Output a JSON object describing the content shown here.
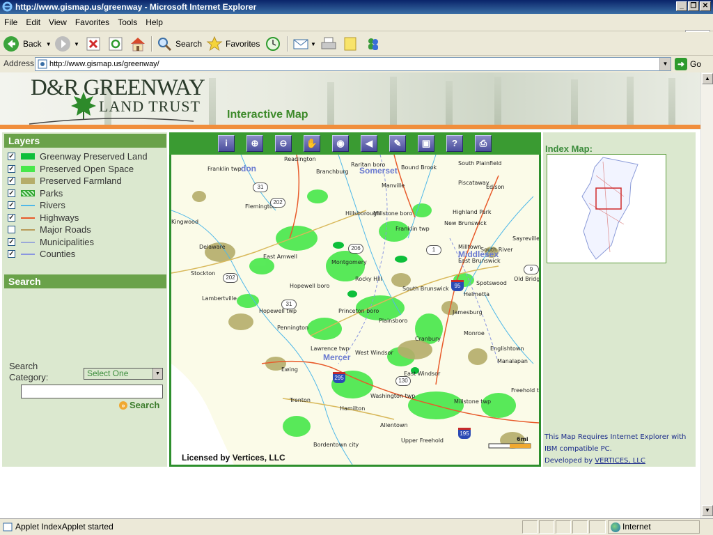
{
  "window": {
    "title": "http://www.gismap.us/greenway - Microsoft Internet Explorer"
  },
  "menu": [
    "File",
    "Edit",
    "View",
    "Favorites",
    "Tools",
    "Help"
  ],
  "toolbar": {
    "back": "Back",
    "search": "Search",
    "favorites": "Favorites"
  },
  "address": {
    "label": "Address",
    "url": "http://www.gismap.us/greenway/",
    "go": "Go"
  },
  "status": {
    "text": "Applet IndexApplet started",
    "zone": "Internet"
  },
  "header": {
    "logo_line1": "D&R GREENWAY",
    "logo_line2": "LAND TRUST",
    "title": "Interactive Map"
  },
  "layers_panel": {
    "title": "Layers",
    "items": [
      {
        "label": "Greenway Preserved Land",
        "checked": true,
        "swatch": "#0dbf3a"
      },
      {
        "label": "Preserved Open Space",
        "checked": true,
        "swatch": "#47e84a"
      },
      {
        "label": "Preserved Farmland",
        "checked": true,
        "swatch": "#b5ad6a"
      },
      {
        "label": "Parks",
        "checked": true,
        "swatch": "#2ea52e"
      },
      {
        "label": "Rivers",
        "checked": true,
        "swatch": "#4fb8e8"
      },
      {
        "label": "Highways",
        "checked": true,
        "swatch": "#e85a2a"
      },
      {
        "label": "Major Roads",
        "checked": false,
        "swatch": "#b89b5a"
      },
      {
        "label": "Municipalities",
        "checked": true,
        "swatch": "#9aa8d8"
      },
      {
        "label": "Counties",
        "checked": true,
        "swatch": "#8a96e0"
      }
    ]
  },
  "search_panel": {
    "title": "Search",
    "category_label": "Search Category:",
    "category_value": "Select One",
    "button": "Search"
  },
  "map_tools": [
    "info",
    "zoom-in",
    "zoom-out",
    "pan",
    "globe",
    "back",
    "measure",
    "extent",
    "help",
    "print"
  ],
  "map_labels": {
    "towns": [
      "Readington",
      "Franklin twp",
      "Branchburg",
      "Raritan boro",
      "Bound Brook",
      "South Plainfield",
      "Piscataway",
      "Manville",
      "Edison",
      "Flemington",
      "Hillsborough",
      "Millstone boro",
      "Highland Park",
      "New Brunswick",
      "Kingwood",
      "Franklin twp",
      "Sayreville",
      "Delaware",
      "East Amwell",
      "Montgomery",
      "Milltown",
      "South River",
      "East Brunswick",
      "Old Bridge",
      "Stockton",
      "Hopewell boro",
      "Rocky Hill",
      "South Brunswick",
      "Spotswood",
      "Lambertville",
      "Helmetta",
      "Hopewell twp",
      "Princeton boro",
      "Jamesburg",
      "Plainsboro",
      "Pennington",
      "Cranbury",
      "Monroe",
      "Lawrence twp",
      "West Windsor",
      "Englishtown",
      "Ewing",
      "East Windsor",
      "Manalapan",
      "Freehold tw",
      "Trenton",
      "Hamilton",
      "Washington twp",
      "Millstone twp",
      "Allentown",
      "Upper Freehold",
      "Bordentown city"
    ],
    "counties": [
      "Somerset",
      "Middlesex",
      "Mercer",
      "don"
    ],
    "routes": [
      "31",
      "202",
      "206",
      "1",
      "9",
      "202",
      "31",
      "130"
    ],
    "interstates": [
      "95",
      "295",
      "195"
    ],
    "scale": "6mi",
    "license": "Licensed by Vertices, LLC"
  },
  "index_panel": {
    "title": "Index Map:",
    "note_line1": "This Map Requires Internet Explorer with",
    "note_line2": "IBM compatible PC.",
    "note_line3": "Developed by ",
    "note_link": "VERTICES, LLC"
  }
}
